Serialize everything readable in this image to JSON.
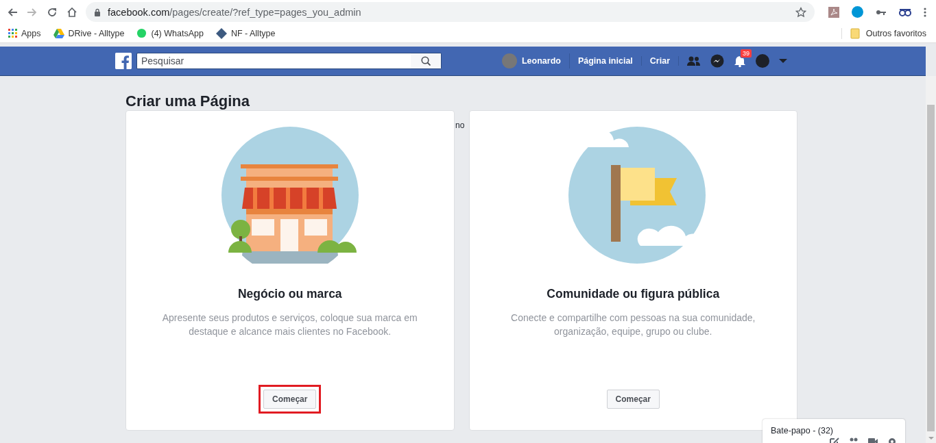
{
  "browser": {
    "url_host": "facebook.com",
    "url_path": "/pages/create/?ref_type=pages_you_admin",
    "bookmarks": [
      {
        "kind": "apps",
        "label": "Apps"
      },
      {
        "kind": "drive",
        "label": "DRive - Alltype"
      },
      {
        "kind": "whatsapp",
        "label": "(4) WhatsApp"
      },
      {
        "kind": "diamond",
        "label": "NF - Alltype"
      }
    ],
    "other_bookmarks": "Outros favoritos"
  },
  "header": {
    "search": {
      "placeholder": "Pesquisar"
    },
    "profile_name": "Leonardo",
    "nav_links": [
      "Página inicial",
      "Criar"
    ],
    "notification_count": "39"
  },
  "page_title": "Criar uma Página",
  "partial_text": "no",
  "cards": [
    {
      "kind": "business",
      "title": "Negócio ou marca",
      "description": "Apresente seus produtos e serviços, coloque sua marca em destaque e alcance mais clientes no Facebook.",
      "button": "Começar",
      "highlighted": true
    },
    {
      "kind": "community",
      "title": "Comunidade ou figura pública",
      "description": "Conecte e compartilhe com pessoas na sua comunidade, organização, equipe, grupo ou clube.",
      "button": "Começar",
      "highlighted": false
    }
  ],
  "chat": {
    "label": "Bate-papo - (32)"
  }
}
